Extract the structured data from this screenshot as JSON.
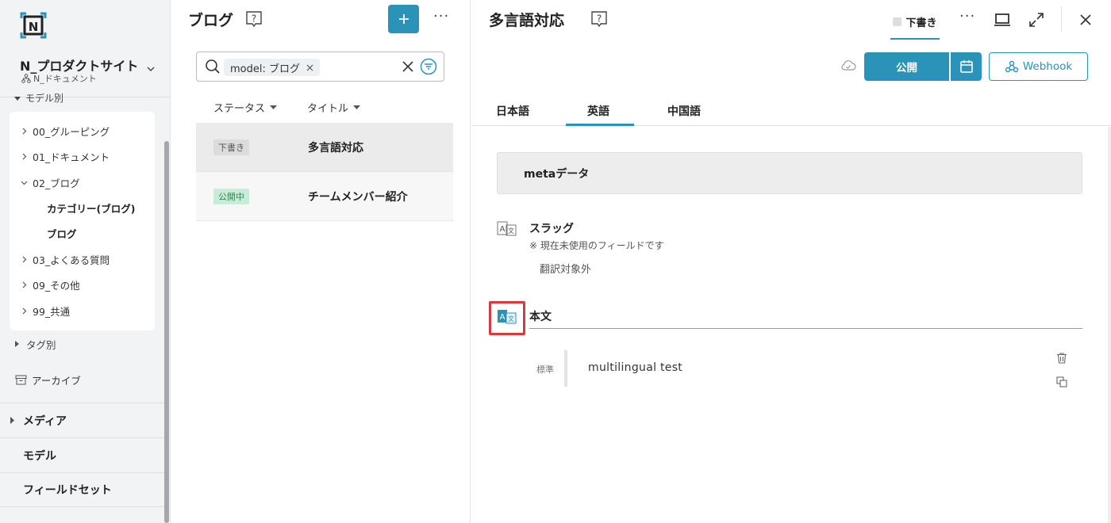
{
  "sidebar": {
    "site_name": "N_プロダクトサイト",
    "site_sub": "N_ドキュメント",
    "model_section": "モデル別",
    "tree": [
      {
        "label": "00_グルーピング"
      },
      {
        "label": "01_ドキュメント"
      },
      {
        "label": "02_ブログ"
      },
      {
        "label": "03_よくある質問"
      },
      {
        "label": "09_その他"
      },
      {
        "label": "99_共通"
      }
    ],
    "sub_items": [
      "カテゴリー(ブログ)",
      "ブログ"
    ],
    "tag_section": "タグ別",
    "archive": "アーカイブ",
    "nav": [
      "メディア",
      "モデル",
      "フィールドセット"
    ]
  },
  "list": {
    "title": "ブログ",
    "search_chip": "model: ブログ",
    "columns": [
      "ステータス",
      "タイトル"
    ],
    "rows": [
      {
        "status": "下書き",
        "title": "多言語対応"
      },
      {
        "status": "公開中",
        "title": "チームメンバー紹介"
      }
    ]
  },
  "detail": {
    "title": "多言語対応",
    "draft_tab": "下書き",
    "publish_label": "公開",
    "webhook_label": "Webhook",
    "lang_tabs": [
      "日本語",
      "英語",
      "中国語"
    ],
    "active_lang": "英語",
    "meta_label": "metaデータ",
    "slug_title": "スラッグ",
    "slug_note": "※ 現在未使用のフィールドです",
    "slug_value": "翻訳対象外",
    "body_title": "本文",
    "std_label": "標準",
    "std_text": "multilingual test"
  },
  "colors": {
    "accent": "#2b93b8",
    "highlight": "#d63b3b"
  }
}
